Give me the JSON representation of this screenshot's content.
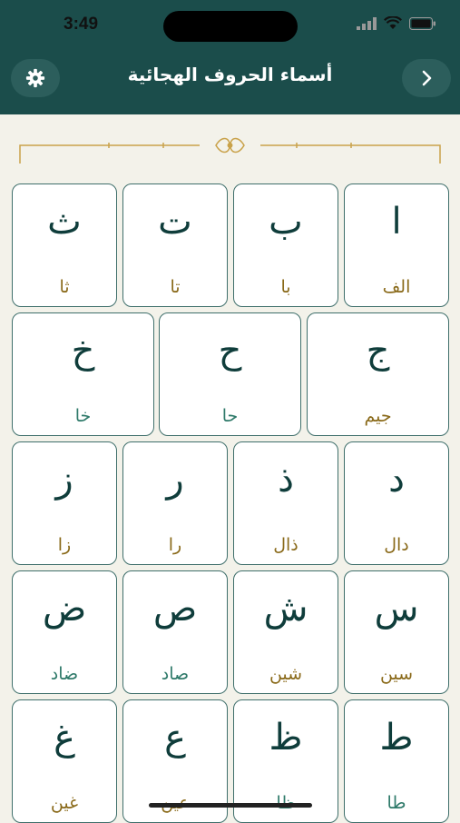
{
  "status_bar": {
    "time": "3:49"
  },
  "header": {
    "title": "أسماء الحروف الهجائية",
    "settings_icon": "gear-icon",
    "back_icon": "chevron-right-icon"
  },
  "colors": {
    "header_bg": "#1b4d4b",
    "page_bg": "#f3f2ea",
    "letter": "#0f3d3b",
    "name_gold": "#8a6a1a",
    "name_teal": "#2f7a6a",
    "card_border": "#3f6f6b"
  },
  "rows": [
    {
      "cards": [
        {
          "letter": "ا",
          "name": "الف",
          "tone": "gold"
        },
        {
          "letter": "ب",
          "name": "با",
          "tone": "gold"
        },
        {
          "letter": "ت",
          "name": "تا",
          "tone": "gold"
        },
        {
          "letter": "ث",
          "name": "ثا",
          "tone": "gold"
        }
      ]
    },
    {
      "cards": [
        {
          "letter": "ج",
          "name": "جيم",
          "tone": "gold"
        },
        {
          "letter": "ح",
          "name": "حا",
          "tone": "teal"
        },
        {
          "letter": "خ",
          "name": "خا",
          "tone": "teal"
        }
      ]
    },
    {
      "cards": [
        {
          "letter": "د",
          "name": "دال",
          "tone": "gold"
        },
        {
          "letter": "ذ",
          "name": "ذال",
          "tone": "gold"
        },
        {
          "letter": "ر",
          "name": "را",
          "tone": "gold"
        },
        {
          "letter": "ز",
          "name": "زا",
          "tone": "gold"
        }
      ]
    },
    {
      "cards": [
        {
          "letter": "س",
          "name": "سين",
          "tone": "gold"
        },
        {
          "letter": "ش",
          "name": "شين",
          "tone": "gold"
        },
        {
          "letter": "ص",
          "name": "صاد",
          "tone": "teal"
        },
        {
          "letter": "ض",
          "name": "ضاد",
          "tone": "teal"
        }
      ]
    },
    {
      "cards": [
        {
          "letter": "ط",
          "name": "طا",
          "tone": "teal"
        },
        {
          "letter": "ظ",
          "name": "ظا",
          "tone": "teal"
        },
        {
          "letter": "ع",
          "name": "عين",
          "tone": "gold"
        },
        {
          "letter": "غ",
          "name": "غين",
          "tone": "gold"
        }
      ]
    }
  ]
}
